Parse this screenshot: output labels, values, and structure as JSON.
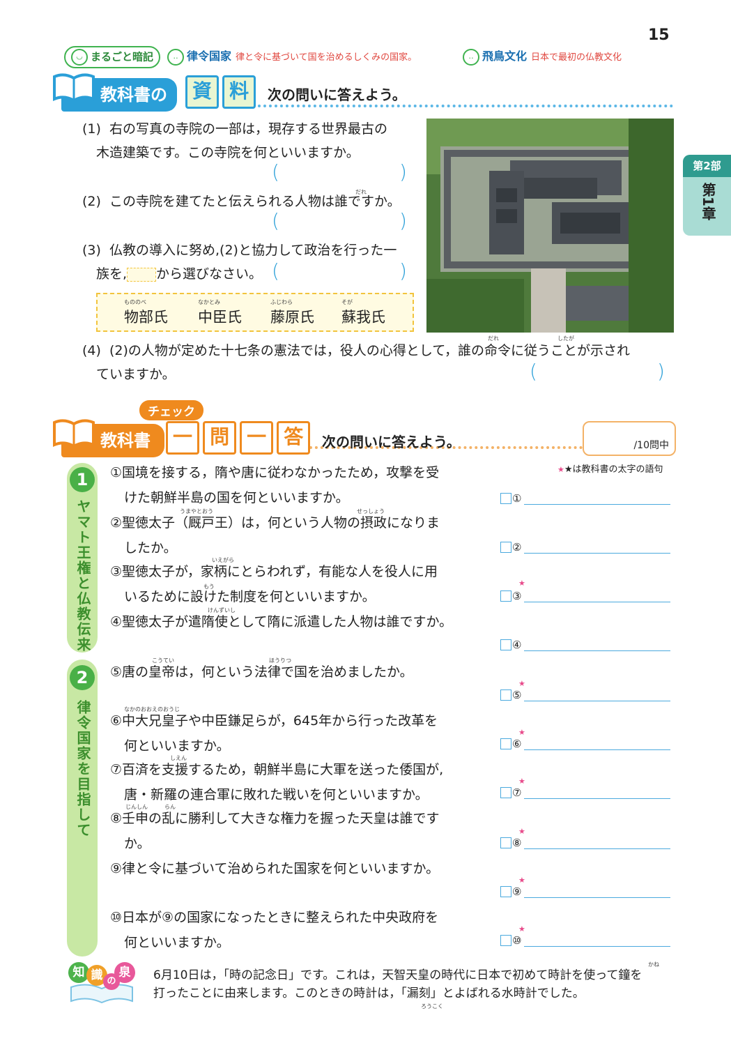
{
  "page_number": "15",
  "summary": {
    "badge": "まるごと暗記",
    "items": [
      {
        "term": "律令国家",
        "def": "律と令に基づいて国を治めるしくみの国家。"
      },
      {
        "term": "飛鳥文化",
        "def": "日本で最初の仏教文化"
      }
    ]
  },
  "section1": {
    "head": "教科書の",
    "head_boxes": [
      "資",
      "料"
    ],
    "instruction": "次の問いに答えよう。",
    "q1": {
      "num": "(1)",
      "lines": [
        "右の写真の寺院の一部は，現存する世界最古の",
        "木造建築です。この寺院を何といいますか。"
      ]
    },
    "q2": {
      "num": "(2)",
      "text": "この寺院を建てたと伝えられる人物は誰ですか。",
      "ruby": "だれ"
    },
    "q3": {
      "num": "(3)",
      "lines": [
        "仏教の導入に努め,(2)と協力して政治を行った一",
        "族を,",
        "から選びなさい。"
      ]
    },
    "choices": [
      {
        "ruby": "もののべ",
        "name": "物部氏"
      },
      {
        "ruby": "なかとみ",
        "name": "中臣氏"
      },
      {
        "ruby": "ふじわら",
        "name": "藤原氏"
      },
      {
        "ruby": "そが",
        "name": "蘇我氏"
      }
    ],
    "q4": {
      "num": "(4)",
      "lines": [
        "(2)の人物が定めた十七条の憲法では，役人の心得として，誰の命令に従うことが示され",
        "ていますか。"
      ],
      "ruby1": "だれ",
      "ruby2": "したが"
    }
  },
  "tab": {
    "part": "第2部",
    "chapter": "第1章"
  },
  "section2": {
    "badge": "チェック",
    "head": "教科書",
    "head_boxes": [
      "一",
      "問",
      "一",
      "答"
    ],
    "instruction": "次の問いに答えよう。",
    "score_label": "/10問中",
    "star_note": "★は教科書の太字の語句",
    "groups": [
      {
        "num": "1",
        "title": "ヤマト王権と仏教伝来"
      },
      {
        "num": "2",
        "title": "律令国家を目指して"
      }
    ],
    "questions": [
      {
        "lines": [
          "①国境を接する，隋や唐に従わなかったため，攻撃を受",
          "けた朝鮮半島の国を何といいますか。"
        ]
      },
      {
        "lines": [
          "②聖徳太子（厩戸王）は，何という人物の摂政になりま",
          "したか。"
        ],
        "ruby": [
          "うまやとおう",
          "せっしょう"
        ]
      },
      {
        "lines": [
          "③聖徳太子が，家柄にとらわれず，有能な人を役人に用",
          "いるために設けた制度を何といいますか。"
        ],
        "ruby": [
          "いえがら",
          "もう"
        ]
      },
      {
        "lines": [
          "④聖徳太子が遣隋使として隋に派遣した人物は誰ですか。"
        ],
        "ruby": [
          "けんずいし"
        ]
      },
      {
        "lines": [
          "⑤唐の皇帝は，何という法律で国を治めましたか。"
        ],
        "ruby": [
          "こうてい",
          "ほうりつ"
        ]
      },
      {
        "lines": [
          "⑥中大兄皇子や中臣鎌足らが，645年から行った改革を",
          "何といいますか。"
        ],
        "ruby": [
          "なかのおおえのおうじ"
        ]
      },
      {
        "lines": [
          "⑦百済を支援するため，朝鮮半島に大軍を送った倭国が,",
          "唐・新羅の連合軍に敗れた戦いを何といいますか。"
        ],
        "ruby": [
          "しえん"
        ]
      },
      {
        "lines": [
          "⑧壬申の乱に勝利して大きな権力を握った天皇は誰です",
          "か。"
        ],
        "ruby": [
          "じんしん",
          "らん"
        ]
      },
      {
        "lines": [
          "⑨律と令に基づいて治められた国家を何といいますか。"
        ]
      },
      {
        "lines": [
          "⑩日本が⑨の国家になったときに整えられた中央政府を",
          "何といいますか。"
        ]
      }
    ],
    "answers": [
      {
        "label": "①",
        "star": false
      },
      {
        "label": "②",
        "star": false
      },
      {
        "label": "③",
        "star": true
      },
      {
        "label": "④",
        "star": false
      },
      {
        "label": "⑤",
        "star": true
      },
      {
        "label": "⑥",
        "star": true
      },
      {
        "label": "⑦",
        "star": true
      },
      {
        "label": "⑧",
        "star": true
      },
      {
        "label": "⑨",
        "star": true
      },
      {
        "label": "⑩",
        "star": true
      }
    ]
  },
  "tip": {
    "badge_chars": [
      "知",
      "識",
      "の",
      "泉"
    ],
    "lines": [
      "6月10日は，「時の記念日」です。これは，天智天皇の時代に日本で初めて時計を使って鐘を",
      "打ったことに由来します。このときの時計は，「漏刻」とよばれる水時計でした。"
    ],
    "ruby": [
      "かね",
      "ろうこく"
    ]
  }
}
